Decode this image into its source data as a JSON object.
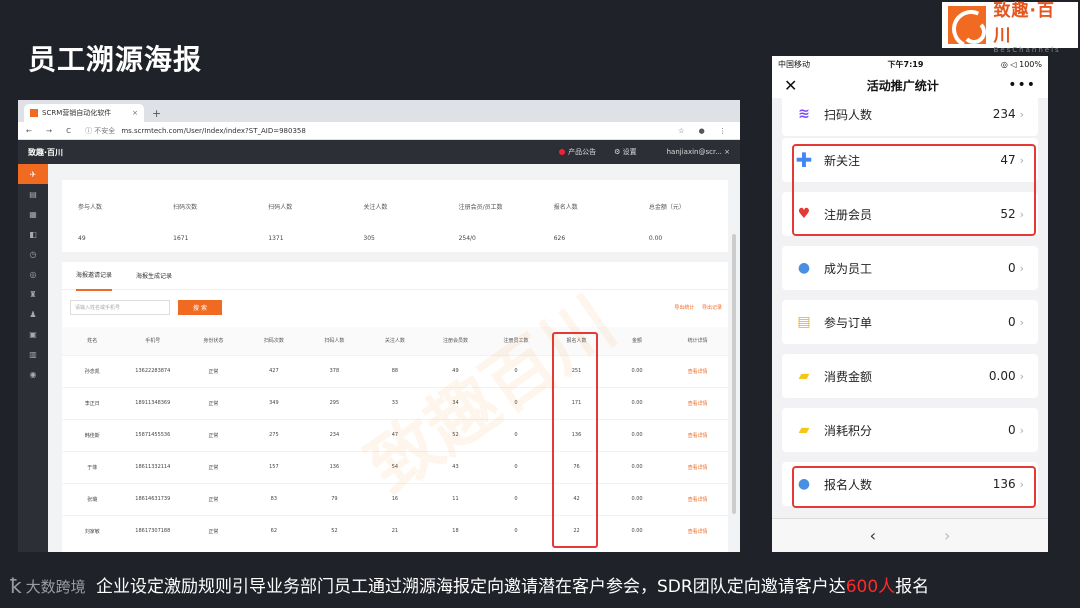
{
  "slide": {
    "title": "员工溯源海报",
    "caption_pre": "企业设定激励规则引导业务部门员工通过溯源海报定向邀请潜在客户参会，SDR团队定向邀请客户达",
    "caption_highlight": "600人",
    "caption_post": "报名",
    "brand_mark": "大数跨境",
    "colors": {
      "accent": "#f06a22",
      "highlight": "#e53935"
    }
  },
  "logo": {
    "cn": "致趣·百川",
    "en": "BesChannels"
  },
  "browser": {
    "tab_title": "SCRM营销自动化软件",
    "tab_close": "×",
    "new_tab": "+",
    "nav": "← → C",
    "insecure": "ⓘ 不安全",
    "url": "ms.scrmtech.com/User/Index/index?ST_AID=980358",
    "toolbar_icons": "☆ ● ⋮",
    "app_brand": "致趣·百川",
    "announcement": "产品公告",
    "settings": "⚙ 设置",
    "user": "hanjiaxin@scr...  ×",
    "sidebar_icons": [
      "✈",
      "▤",
      "▦",
      "◧",
      "◷",
      "◎",
      "♜",
      "♟",
      "▣",
      "▥",
      "◉"
    ],
    "stats": [
      {
        "label": "参与人数",
        "value": "49"
      },
      {
        "label": "扫码次数",
        "value": "1671"
      },
      {
        "label": "扫码人数",
        "value": "1371"
      },
      {
        "label": "关注人数",
        "value": "305"
      },
      {
        "label": "注册会员/员工数",
        "value": "254/0"
      },
      {
        "label": "报名人数",
        "value": "626"
      },
      {
        "label": "总金额（元）",
        "value": "0.00"
      }
    ],
    "subtabs": [
      "海报邀请记录",
      "海报生成记录"
    ],
    "search_placeholder": "请输入姓名或手机号",
    "search_button": "搜 索",
    "export1": "导出统计",
    "export2": "导出记录",
    "columns": [
      "姓名",
      "手机号",
      "身份状态",
      "扫码次数",
      "扫码人数",
      "关注人数",
      "注册会员数",
      "注册员工数",
      "报名人数",
      "金额",
      "统计详情"
    ],
    "rows": [
      [
        "孙念凯",
        "13622283874",
        "正常",
        "427",
        "378",
        "88",
        "49",
        "0",
        "251",
        "0.00",
        "查看详情"
      ],
      [
        "李正日",
        "18911348369",
        "正常",
        "349",
        "295",
        "33",
        "34",
        "0",
        "171",
        "0.00",
        "查看详情"
      ],
      [
        "韩佳斯",
        "15871455536",
        "正常",
        "275",
        "234",
        "47",
        "52",
        "0",
        "136",
        "0.00",
        "查看详情"
      ],
      [
        "于菲",
        "18611332114",
        "正常",
        "157",
        "136",
        "54",
        "43",
        "0",
        "76",
        "0.00",
        "查看详情"
      ],
      [
        "张璐",
        "18614631739",
        "正常",
        "83",
        "79",
        "16",
        "11",
        "0",
        "42",
        "0.00",
        "查看详情"
      ],
      [
        "刘家敏",
        "18617307188",
        "正常",
        "62",
        "52",
        "21",
        "18",
        "0",
        "22",
        "0.00",
        "查看详情"
      ]
    ],
    "watermark": "致趣百川"
  },
  "phone": {
    "carrier": "中国移动",
    "time": "下午7:19",
    "battery": "◎ ◁ 100%",
    "title": "活动推广统计",
    "back": "✕",
    "more": "•••",
    "items": [
      {
        "label": "扫码人数",
        "value": "234",
        "icon": "scan-icon",
        "glyph": "≋"
      },
      {
        "label": "新关注",
        "value": "47",
        "icon": "plus-icon",
        "glyph": "✚"
      },
      {
        "label": "注册会员",
        "value": "52",
        "icon": "heart-pulse-icon",
        "glyph": "♥"
      },
      {
        "label": "成为员工",
        "value": "0",
        "icon": "person-icon",
        "glyph": "●"
      },
      {
        "label": "参与订单",
        "value": "0",
        "icon": "clipboard-icon",
        "glyph": "▤"
      },
      {
        "label": "消费金额",
        "value": "0.00",
        "icon": "ticket-icon",
        "glyph": "▰"
      },
      {
        "label": "消耗积分",
        "value": "0",
        "icon": "ticket-icon",
        "glyph": "▰"
      },
      {
        "label": "报名人数",
        "value": "136",
        "icon": "person-icon",
        "glyph": "●"
      }
    ],
    "chevron": "›",
    "nav_back": "‹",
    "nav_forward": "›"
  }
}
